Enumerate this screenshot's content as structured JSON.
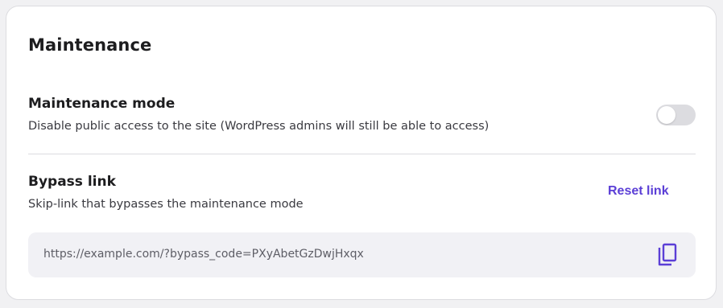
{
  "section": {
    "title": "Maintenance"
  },
  "maintenance_mode": {
    "title": "Maintenance mode",
    "description": "Disable public access to the site (WordPress admins will still be able to access)",
    "enabled": false
  },
  "bypass_link": {
    "title": "Bypass link",
    "description": "Skip-link that bypasses the maintenance mode",
    "reset_label": "Reset link",
    "url": "https://example.com/?bypass_code=PXyAbetGzDwjHxqx",
    "copy_icon": "copy-icon"
  },
  "colors": {
    "accent": "#5b3fd6",
    "toggle_off": "#dcdce0",
    "link_box_bg": "#f1f1f5"
  }
}
